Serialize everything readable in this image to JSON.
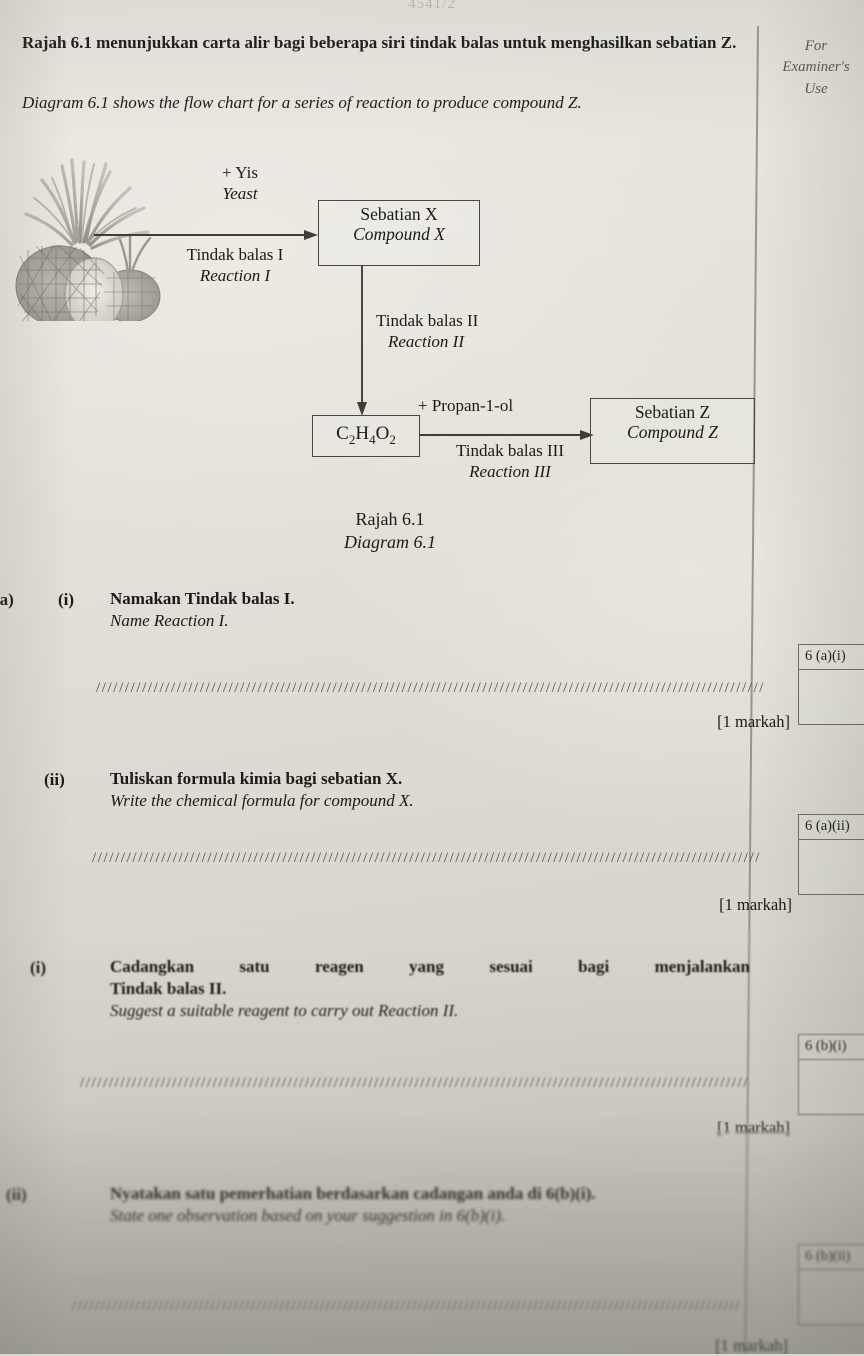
{
  "paper_code": "4541/2",
  "examiner_column": {
    "label": "For\nExaminer's\nUse",
    "label_line1": "For",
    "label_line2": "Examiner's",
    "label_line3": "Use",
    "boxes": [
      {
        "code": "6 (a)(i)"
      },
      {
        "code": "6 (a)(ii)"
      },
      {
        "code": "6 (b)(i)"
      },
      {
        "code": "6 (b)(ii)"
      }
    ]
  },
  "intro": {
    "malay": "Rajah 6.1 menunjukkan carta alir bagi beberapa siri tindak balas untuk menghasilkan sebatian Z.",
    "english": "Diagram 6.1 shows the  flow chart for a series of reaction to produce compound Z."
  },
  "flowchart": {
    "source_image": "pineapple-illustration",
    "reagent1_line1": "+ Yis",
    "reagent1_line2": "Yeast",
    "reaction1_line1": "Tindak balas I",
    "reaction1_line2": "Reaction I",
    "box_x_line1": "Sebatian X",
    "box_x_line2": "Compound X",
    "reaction2_line1": "Tindak balas II",
    "reaction2_line2": "Reaction II",
    "box_formula": "C2H4O2",
    "box_formula_parts": {
      "c": "C",
      "c_sub": "2",
      "h": "H",
      "h_sub": "4",
      "o": "O",
      "o_sub": "2"
    },
    "reagent3": "+  Propan-1-ol",
    "reaction3_line1": "Tindak balas III",
    "reaction3_line2": "Reaction III",
    "box_z_line1": "Sebatian Z",
    "box_z_line2": "Compound Z",
    "caption_line1": "Rajah 6.1",
    "caption_line2": "Diagram 6.1"
  },
  "questions": [
    {
      "part": "(a)",
      "number": "(i)",
      "malay": "Namakan Tindak balas I.",
      "english": "Name Reaction I.",
      "marks": "[1 markah]"
    },
    {
      "part": "",
      "number": "(ii)",
      "malay": "Tuliskan formula kimia bagi sebatian X.",
      "english": "Write the chemical formula for compound X.",
      "marks": "[1 markah]"
    },
    {
      "part": "",
      "number": "(i)",
      "malay": "Cadangkan satu reagen yang sesuai bagi menjalankan Tindak balas II.",
      "malay_line1": "Cadangkan satu reagen yang sesuai bagi menjalankan",
      "malay_line2": "Tindak balas II.",
      "english": "Suggest a suitable reagent to carry out Reaction II.",
      "marks": "[1 markah]"
    },
    {
      "part": "",
      "number": "(ii)",
      "malay": "Nyatakan satu pemerhatian berdasarkan cadangan anda di 6(b)(i).",
      "english": "State one observation based on your suggestion in 6(b)(i).",
      "marks": "[1 markah]"
    }
  ],
  "dots": "////////////////////////////////////////////////////////////////////////////////////////////////////////////////////"
}
